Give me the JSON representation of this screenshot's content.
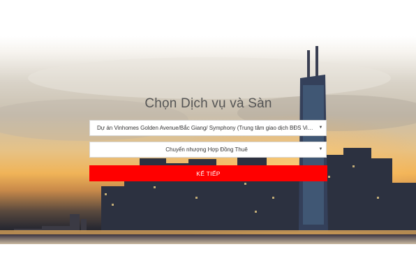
{
  "form": {
    "title": "Chọn Dịch vụ và Sàn",
    "project_select": {
      "value": "Dự án Vinhomes Golden Avenue/Bắc Giang/ Symphony (Trung tâm giao dịch BĐS Vinh..."
    },
    "service_select": {
      "value": "Chuyển nhượng Hợp Đồng Thuê"
    },
    "next_label": "KẾ TIẾP"
  },
  "icons": {
    "dropdown": "▼"
  },
  "colors": {
    "accent": "#ff0000",
    "title": "#555555"
  }
}
